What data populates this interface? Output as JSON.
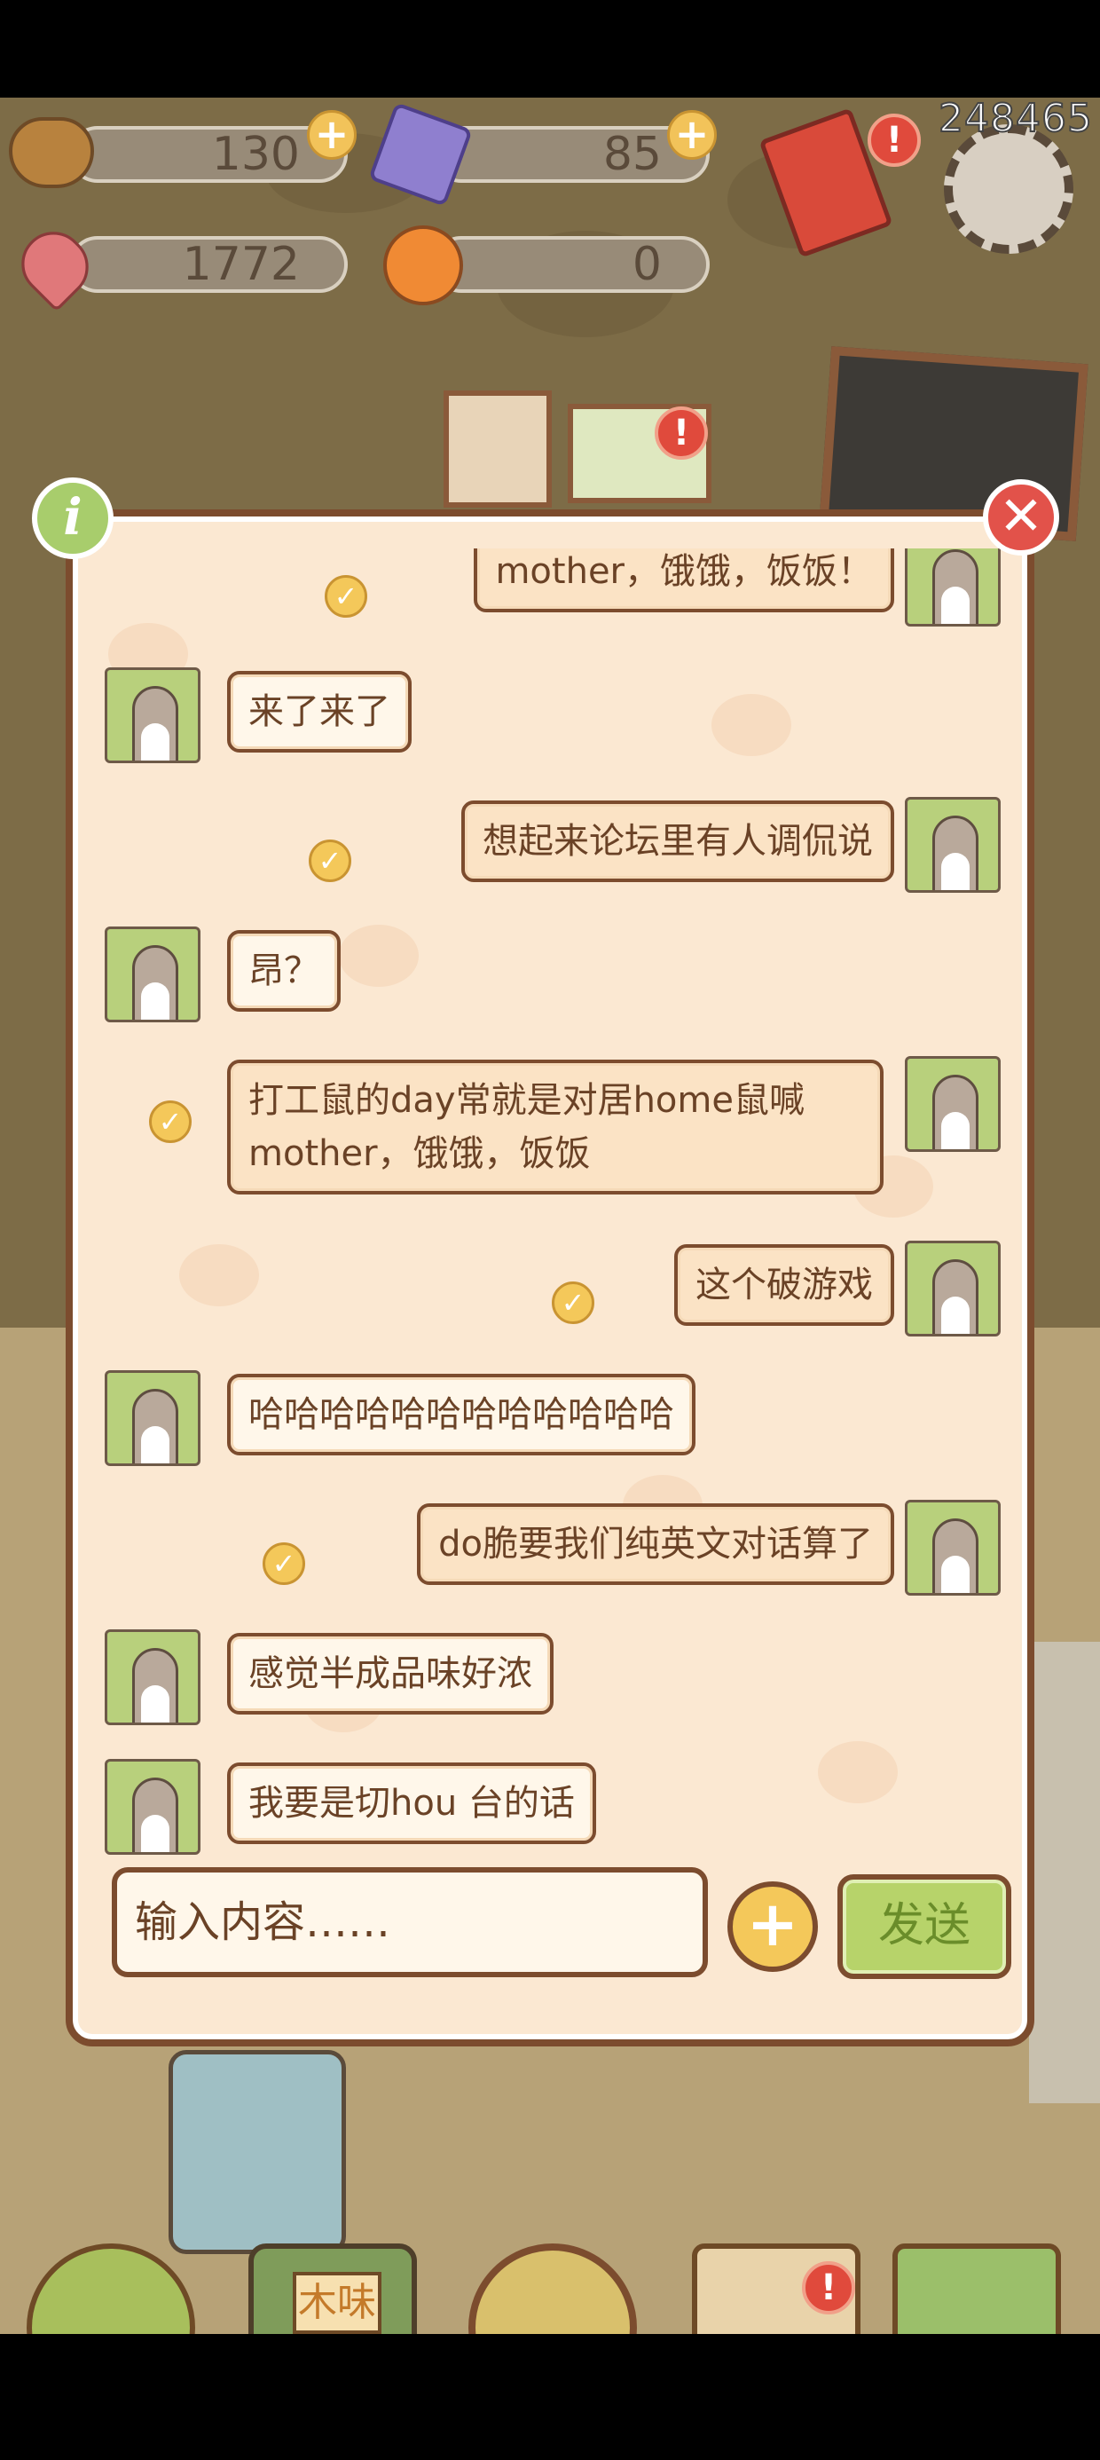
{
  "resources": {
    "acorn": "130",
    "crystal": "85",
    "heart": "1772",
    "orange": "0"
  },
  "top_right_number": "248465",
  "hud_icons": [
    "acorn-icon",
    "crystal-icon",
    "heart-gem-icon",
    "orange-icon",
    "gift-icon",
    "settings-gear-icon"
  ],
  "badges": {
    "plus": "+",
    "alert": "!"
  },
  "chat": {
    "messages": [
      {
        "side": "right",
        "text": "mother，饿饿，饭饭！"
      },
      {
        "side": "left",
        "text": "来了来了"
      },
      {
        "side": "right",
        "text": "想起来论坛里有人调侃说"
      },
      {
        "side": "left",
        "text": "昂？"
      },
      {
        "side": "right",
        "text": "打工鼠的day常就是对居home鼠喊mother，饿饿，饭饭"
      },
      {
        "side": "right",
        "text": "这个破游戏"
      },
      {
        "side": "left",
        "text": "哈哈哈哈哈哈哈哈哈哈哈哈"
      },
      {
        "side": "right",
        "text": "do脆要我们纯英文对话算了"
      },
      {
        "side": "left",
        "text": "感觉半成品味好浓"
      },
      {
        "side": "left",
        "text": "我要是切hou 台的话"
      }
    ],
    "input_placeholder": "输入内容……",
    "send_label": "发送",
    "plus_label": "+",
    "info_label": "i",
    "close_label": "✕",
    "check_glyph": "✓"
  },
  "bottom_nav": [
    {
      "name": "home-icon"
    },
    {
      "name": "mail-icon",
      "label": "木味"
    },
    {
      "name": "otter-friends-icon"
    },
    {
      "name": "task-clipboard-icon"
    },
    {
      "name": "map-icon"
    }
  ]
}
